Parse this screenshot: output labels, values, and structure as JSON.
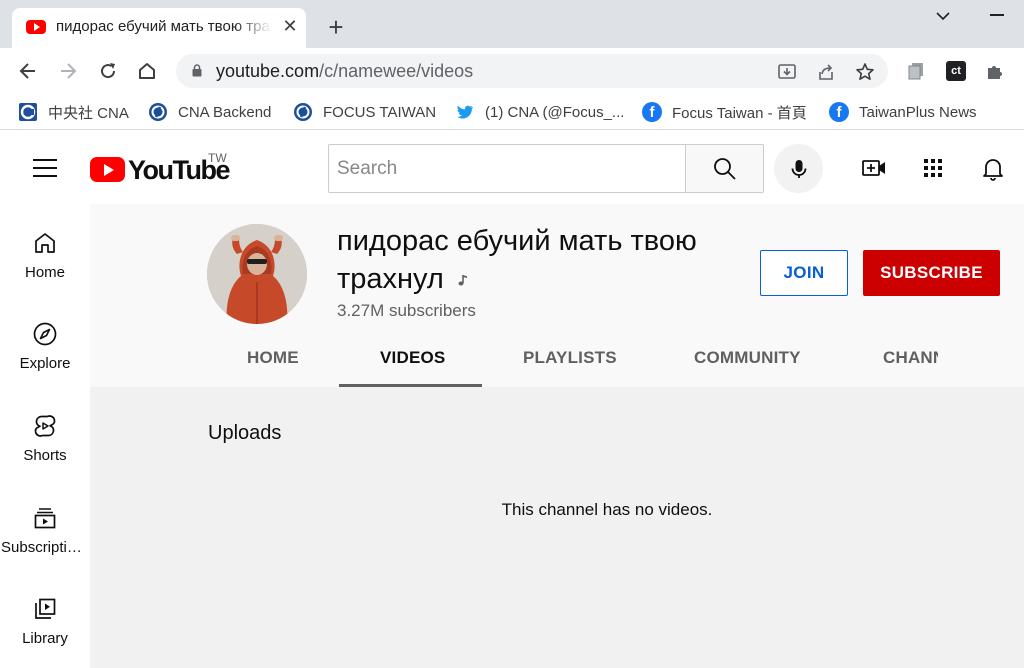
{
  "browser": {
    "tab": {
      "title": "пидорас ебучий мать твою трахнул - YouTube",
      "close_glyph": "✕"
    },
    "new_tab_glyph": "+",
    "address": {
      "host": "youtube.com",
      "path": "/c/namewee/videos"
    },
    "bookmarks": [
      {
        "label": "中央社 CNA",
        "icon": "cna-logo-icon"
      },
      {
        "label": "CNA Backend",
        "icon": "cna-circle-icon"
      },
      {
        "label": "FOCUS TAIWAN",
        "icon": "cna-circle-icon"
      },
      {
        "label": "(1) CNA (@Focus_...",
        "icon": "twitter-icon"
      },
      {
        "label": "Focus Taiwan - 首頁",
        "icon": "facebook-icon"
      },
      {
        "label": "TaiwanPlus News",
        "icon": "facebook-icon"
      }
    ],
    "extension_badge": "ct"
  },
  "youtube": {
    "logo_text": "YouTube",
    "country_code": "TW",
    "search_placeholder": "Search",
    "guide": [
      {
        "label": "Home",
        "icon": "home-icon"
      },
      {
        "label": "Explore",
        "icon": "compass-icon"
      },
      {
        "label": "Shorts",
        "icon": "shorts-icon"
      },
      {
        "label": "Subscriptions",
        "icon": "subscriptions-icon"
      },
      {
        "label": "Library",
        "icon": "library-icon"
      }
    ],
    "channel": {
      "name": "пидорас ебучий мать твою трахнул",
      "subscribers": "3.27M subscribers",
      "join_label": "JOIN",
      "subscribe_label": "SUBSCRIBE",
      "tabs": [
        "HOME",
        "VIDEOS",
        "PLAYLISTS",
        "COMMUNITY",
        "CHANNELS"
      ],
      "active_tab": "VIDEOS"
    },
    "content": {
      "section_title": "Uploads",
      "empty_message": "This channel has no videos."
    }
  },
  "colors": {
    "brand_red": "#ff0000",
    "subscribe_red": "#cc0000",
    "join_blue": "#065fd4"
  }
}
